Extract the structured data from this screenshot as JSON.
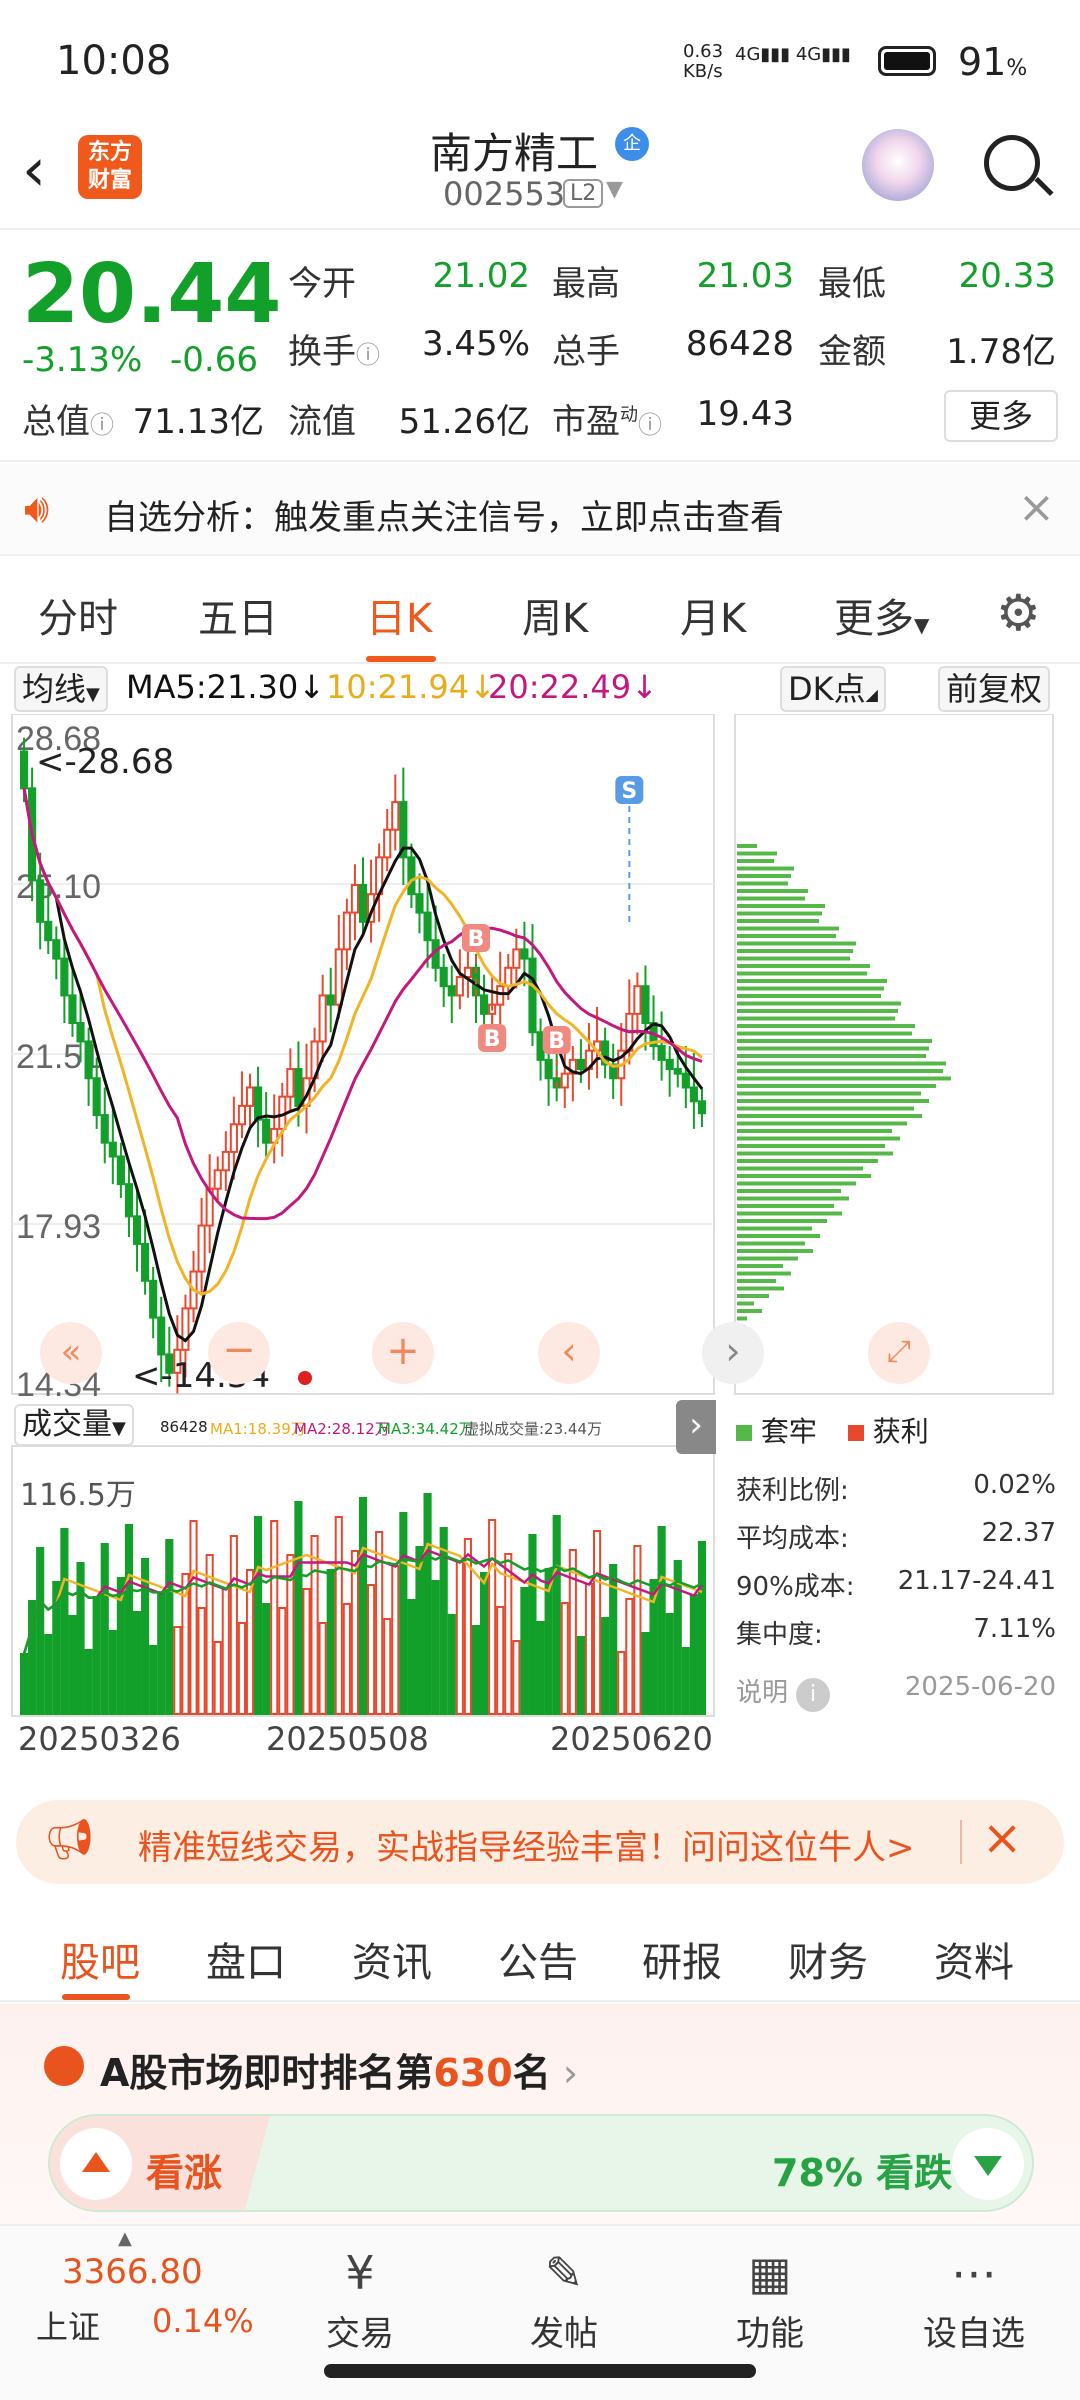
{
  "status": {
    "time": "10:08",
    "net_speed": "0.63",
    "net_unit": "KB/s",
    "signal": "4G▮▮▮ 4G▮▮▮",
    "battery": "91",
    "battery_unit": "%"
  },
  "header": {
    "logo_line1": "东方",
    "logo_line2": "财富",
    "name": "南方精工",
    "badge": "企",
    "code": "002553",
    "level": "L2"
  },
  "quote": {
    "price": "20.44",
    "pct": "-3.13%",
    "chg": "-0.66",
    "open_label": "今开",
    "open": "21.02",
    "high_label": "最高",
    "high": "21.03",
    "low_label": "最低",
    "low": "20.33",
    "turn_label": "换手",
    "turn": "3.45%",
    "vol_label": "总手",
    "vol": "86428",
    "amt_label": "金额",
    "amt": "1.78亿",
    "mcap_label": "总值",
    "mcap": "71.13亿",
    "float_label": "流值",
    "float": "51.26亿",
    "pe_label": "市盈",
    "pe_sup": "动",
    "pe": "19.43",
    "more": "更多"
  },
  "banner1": {
    "text": "自选分析：触发重点关注信号，立即点击查看"
  },
  "tabs": [
    "分时",
    "五日",
    "日K",
    "周K",
    "月K",
    "更多"
  ],
  "active_tab": "日K",
  "ma_row": {
    "selector": "均线",
    "ma5": "MA5:21.30",
    "ma10": "10:21.94",
    "ma20": "20:22.49",
    "dk": "DK点",
    "adjust": "前复权"
  },
  "colors": {
    "up": "#e8492e",
    "down": "#12a02a",
    "ma5": "#111111",
    "ma10": "#f0b428",
    "ma20": "#c4187e"
  },
  "kline": {
    "y_labels": [
      "28.68",
      "25.10",
      "21.51",
      "17.93",
      "14.34"
    ],
    "max_note": "<-28.68",
    "min_note": "<-14.34",
    "signal_s": "S",
    "signal_b": "B"
  },
  "vol": {
    "selector": "成交量",
    "vol": "86428",
    "ma1": "MA1:18.39万",
    "ma2": "MA2:28.12万",
    "ma3": "MA3:34.42万",
    "virt": "虚拟成交量:23.44万",
    "top": "116.5万"
  },
  "dates": [
    "20250326",
    "20250508",
    "20250620"
  ],
  "chip": {
    "legend_trap": "套牢",
    "legend_profit": "获利",
    "rows": [
      {
        "k": "获利比例:",
        "v": "0.02%"
      },
      {
        "k": "平均成本:",
        "v": "22.37"
      },
      {
        "k": "90%成本:",
        "v": "21.17-24.41"
      },
      {
        "k": "集中度:",
        "v": "7.11%"
      }
    ],
    "note": "说明",
    "date": "2025-06-20"
  },
  "banner2": {
    "text": "精准短线交易，实战指导经验丰富！问问这位牛人>"
  },
  "subtabs": [
    "股吧",
    "盘口",
    "资讯",
    "公告",
    "研报",
    "财务",
    "资料"
  ],
  "rank": {
    "prefix": "A股市场即时排名第",
    "num": "630",
    "suffix": "名"
  },
  "vote": {
    "up": "看涨",
    "down": "78% 看跌"
  },
  "bottom": {
    "index_val": "3366.80",
    "index_name": "上证",
    "index_pct": "0.14%",
    "nav": [
      {
        "icon": "¥",
        "label": "交易"
      },
      {
        "icon": "✎",
        "label": "发帖"
      },
      {
        "icon": "▦",
        "label": "功能"
      },
      {
        "icon": "⋯",
        "label": "设自选"
      }
    ]
  }
}
